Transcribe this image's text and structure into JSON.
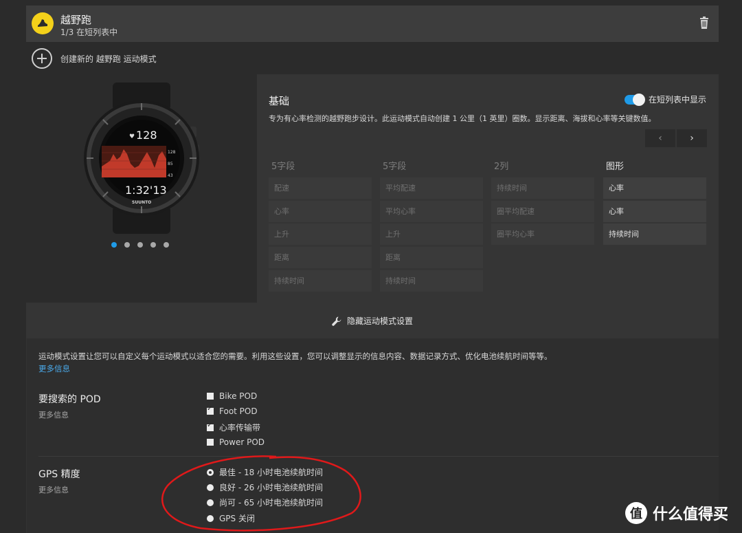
{
  "header": {
    "title": "越野跑",
    "subtitle": "1/3 在短列表中"
  },
  "create": {
    "label": "创建新的 越野跑 运动模式"
  },
  "watch": {
    "heart_rate": "128",
    "time": "1:32'13",
    "brand": "SUUNTO",
    "scale": [
      "128",
      "85",
      "43"
    ]
  },
  "carousel": {
    "count": 5,
    "active": 0
  },
  "basic": {
    "title": "基础",
    "toggle_label": "在短列表中显示",
    "description": "专为有心率检测的越野跑步设计。此运动模式自动创建 1 公里（1 英里）圈数。显示距离、海拔和心率等关键数值。",
    "prev": "‹",
    "next": "›",
    "columns": [
      {
        "header": "5字段",
        "cells": [
          "配速",
          "心率",
          "上升",
          "距离",
          "持续时间"
        ],
        "active": false
      },
      {
        "header": "5字段",
        "cells": [
          "平均配速",
          "平均心率",
          "上升",
          "距离",
          "持续时间"
        ],
        "active": false
      },
      {
        "header": "2列",
        "cells": [
          "持续时间",
          "圈平均配速",
          "圈平均心率"
        ],
        "active": false
      },
      {
        "header": "图形",
        "cells": [
          "心率",
          "心率",
          "持续时间"
        ],
        "active": true
      }
    ]
  },
  "hidden": {
    "label": "隐藏运动模式设置"
  },
  "settings": {
    "intro": "运动模式设置让您可以自定义每个运动模式以适合您的需要。利用这些设置，您可以调整显示的信息内容、数据记录方式、优化电池续航时间等等。",
    "more": "更多信息",
    "pod": {
      "title": "要搜索的 POD",
      "more": "更多信息",
      "options": [
        {
          "label": "Bike POD",
          "checked": false
        },
        {
          "label": "Foot POD",
          "checked": true
        },
        {
          "label": "心率传输带",
          "checked": true
        },
        {
          "label": "Power POD",
          "checked": false
        }
      ]
    },
    "gps": {
      "title": "GPS 精度",
      "more": "更多信息",
      "options": [
        {
          "label": "最佳 - 18 小时电池续航时间",
          "selected": true
        },
        {
          "label": "良好 - 26 小时电池续航时间",
          "selected": false
        },
        {
          "label": "尚可 - 65 小时电池续航时间",
          "selected": false
        },
        {
          "label": "GPS 关闭",
          "selected": false
        }
      ]
    }
  },
  "watermark": {
    "logo": "值",
    "text": "什么值得买"
  },
  "colors": {
    "accent": "#1f9be8",
    "sport_icon": "#f4d11a",
    "annotation": "#e0191a"
  }
}
